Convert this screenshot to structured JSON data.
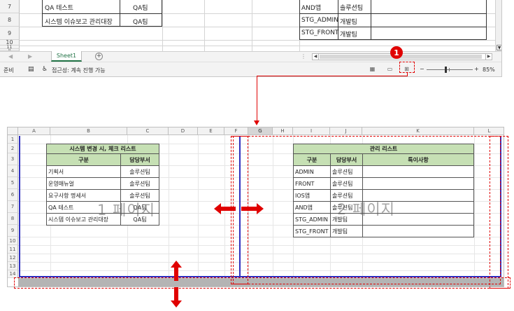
{
  "top": {
    "row_numbers": [
      "7",
      "8",
      "9",
      "10",
      "11",
      "16"
    ],
    "left_table": [
      {
        "item": "QA 테스트",
        "dept": "QA팀"
      },
      {
        "item": "시스템 이슈보고 관리대장",
        "dept": "QA팀"
      }
    ],
    "right_table": [
      {
        "item": "AND앱",
        "dept": "솔루션팀"
      },
      {
        "item": "STG_ADMIN",
        "dept": "개발팀"
      },
      {
        "item": "STG_FRONT",
        "dept": "개발팀"
      }
    ],
    "sheet_tab": "Sheet1",
    "add_sheet": "+",
    "tab_dots": "⋮",
    "status": {
      "ready": "준비",
      "accessibility": "접근성: 계속 진행 가능",
      "zoom_minus": "−",
      "zoom_plus": "+",
      "zoom_level": "85%"
    },
    "badge": "1"
  },
  "sheet": {
    "columns": [
      "A",
      "B",
      "C",
      "D",
      "E",
      "F",
      "G",
      "H",
      "I",
      "J",
      "K",
      "L"
    ],
    "selected_column": "G",
    "rows": [
      "1",
      "2",
      "3",
      "4",
      "5",
      "6",
      "7",
      "8",
      "9",
      "10",
      "11",
      "12",
      "13",
      "14"
    ],
    "table1": {
      "title": "시스템 변경 시, 체크 리스트",
      "headers": [
        "구분",
        "담당부서"
      ],
      "rows": [
        [
          "기획서",
          "솔루션팀"
        ],
        [
          "운영매뉴얼",
          "솔루션팀"
        ],
        [
          "요구사항 명세서",
          "솔루션팀"
        ],
        [
          "QA 테스트",
          "QA팀"
        ],
        [
          "시스템 이슈보고 관리대장",
          "QA팀"
        ]
      ]
    },
    "table2": {
      "title": "관리 리스트",
      "headers": [
        "구분",
        "담당부서",
        "특이사항"
      ],
      "rows": [
        [
          "ADMIN",
          "솔루션팀",
          ""
        ],
        [
          "FRONT",
          "솔루션팀",
          ""
        ],
        [
          "IOS앱",
          "솔루션팀",
          ""
        ],
        [
          "AND앱",
          "솔루션팀",
          ""
        ],
        [
          "STG_ADMIN",
          "개발팀",
          ""
        ],
        [
          "STG_FRONT",
          "개발팀",
          ""
        ]
      ]
    },
    "watermarks": [
      "1 페이지",
      "2 페이지"
    ]
  },
  "colors": {
    "accent_red": "#e00000",
    "header_green": "#c6e0b4",
    "page_break_blue": "#2f2fbf",
    "excel_green": "#217346"
  }
}
